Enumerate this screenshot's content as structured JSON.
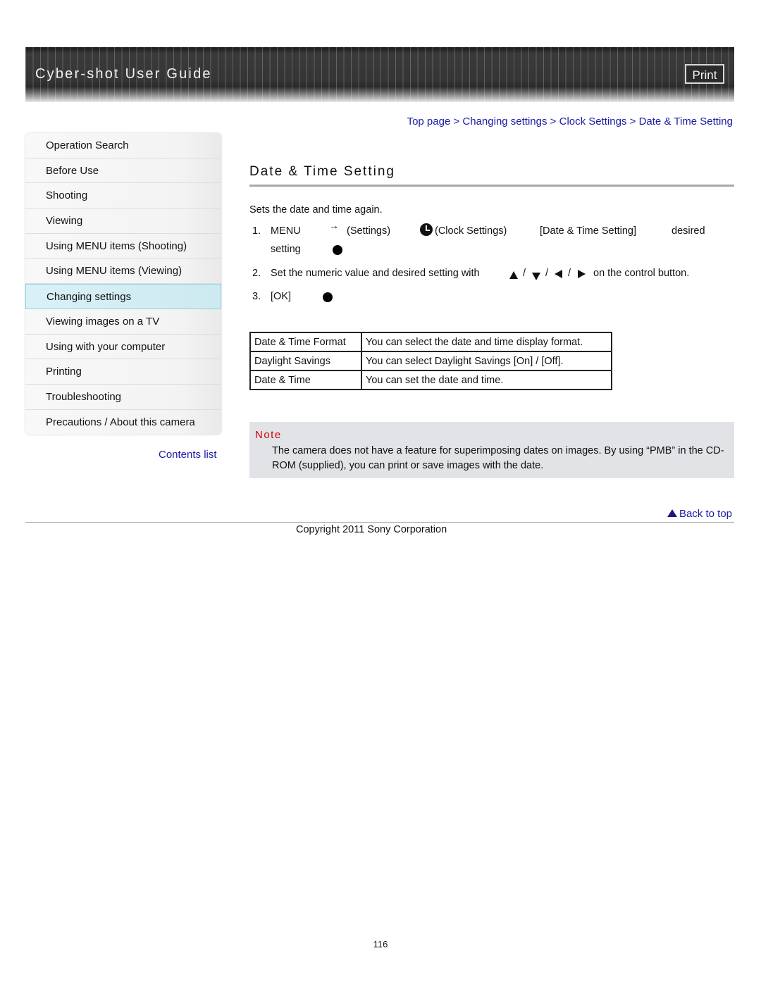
{
  "header": {
    "title": "Cyber-shot User Guide",
    "print_label": "Print"
  },
  "sidebar": {
    "items": [
      {
        "label": "Operation Search"
      },
      {
        "label": "Before Use"
      },
      {
        "label": "Shooting"
      },
      {
        "label": "Viewing"
      },
      {
        "label": "Using MENU items (Shooting)"
      },
      {
        "label": "Using MENU items (Viewing)"
      },
      {
        "label": "Changing settings",
        "active": true
      },
      {
        "label": "Viewing images on a TV"
      },
      {
        "label": "Using with your computer"
      },
      {
        "label": "Printing"
      },
      {
        "label": "Troubleshooting"
      },
      {
        "label": "Precautions / About this camera"
      }
    ],
    "contents_link": "Contents list"
  },
  "breadcrumb": {
    "items": [
      "Top page",
      "Changing settings",
      "Clock Settings",
      "Date & Time Setting"
    ],
    "separator": ">"
  },
  "main": {
    "title": "Date & Time Setting",
    "intro": "Sets the date and time again.",
    "steps": [
      {
        "num": "1.",
        "menu": "MENU",
        "settings": "(Settings)",
        "clock_settings": "(Clock Settings)",
        "item": "[Date & Time Setting]",
        "desired": "desired",
        "setting": "setting"
      },
      {
        "num": "2.",
        "text_before": "Set the numeric value and desired setting with",
        "slash": "/",
        "text_after": "on the control button."
      },
      {
        "num": "3.",
        "text": "[OK]"
      }
    ],
    "icons": {
      "arrow": "right-arrow-icon",
      "settings": "settings-icon",
      "clock": "clock-icon",
      "center_button": "center-button-icon",
      "up": "up-triangle-icon",
      "down": "down-triangle-icon",
      "left": "left-triangle-icon",
      "right": "right-triangle-icon"
    },
    "table": [
      {
        "name": "Date & Time Format",
        "desc": "You can select the date and time display format."
      },
      {
        "name": "Daylight Savings",
        "desc": "You can select Daylight Savings [On] / [Off]."
      },
      {
        "name": "Date & Time",
        "desc": "You can set the date and time."
      }
    ],
    "note": {
      "title": "Note",
      "text": "The camera does not have a feature for superimposing dates on images. By using “PMB” in the CD-ROM (supplied), you can print or save images with the date."
    }
  },
  "footer": {
    "back_to_top": "Back to top",
    "copyright": "Copyright 2011 Sony Corporation",
    "page_number": "116"
  },
  "colors": {
    "link": "#1a1aa6",
    "note_title": "#d00000",
    "note_bg": "#e1e3e7",
    "active_item_bg": "#d4eef4"
  }
}
